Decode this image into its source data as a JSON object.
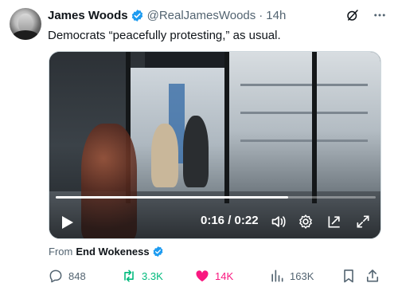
{
  "author": {
    "name": "James Woods",
    "handle": "@RealJamesWoods",
    "separator": "·",
    "time": "14h"
  },
  "tweet": {
    "text": "Democrats “peacefully protesting,” as usual."
  },
  "video": {
    "current_time": "0:16",
    "duration": "0:22",
    "time_display": "0:16 / 0:22",
    "progress_fraction": 0.7273
  },
  "source": {
    "prefix": "From",
    "name": "End Wokeness"
  },
  "actions": {
    "replies": "848",
    "retweets": "3.3K",
    "likes": "14K",
    "views": "163K"
  },
  "icons": {
    "verified": "verified-badge-icon",
    "grok": "grok-icon",
    "more": "more-icon",
    "play": "play-icon",
    "volume": "volume-icon",
    "settings": "gear-icon",
    "dock": "dock-icon",
    "fullscreen": "fullscreen-icon",
    "reply": "reply-icon",
    "retweet": "retweet-icon",
    "like": "heart-icon",
    "views": "views-icon",
    "bookmark": "bookmark-icon",
    "share": "share-icon"
  },
  "colors": {
    "verified_blue": "#1d9bf0",
    "retweet_green": "#00ba7c",
    "like_pink": "#f91880",
    "secondary_text": "#536471"
  }
}
